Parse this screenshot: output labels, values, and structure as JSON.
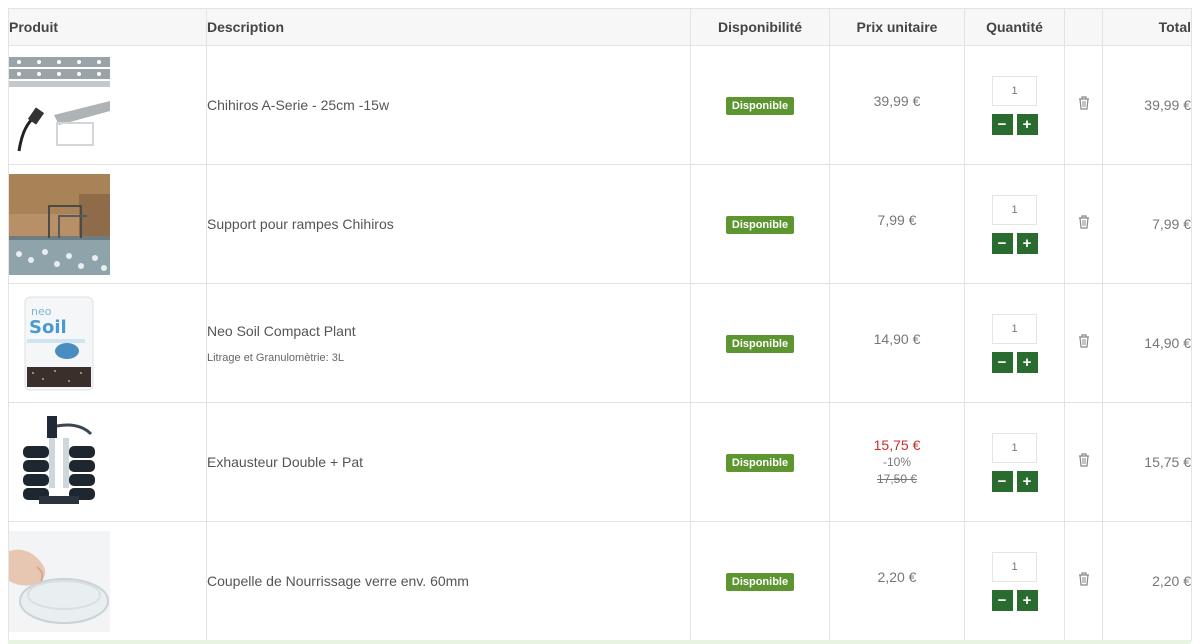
{
  "headers": {
    "product": "Produit",
    "description": "Description",
    "availability": "Disponibilité",
    "unit_price": "Prix unitaire",
    "quantity": "Quantité",
    "remove": "",
    "total": "Total"
  },
  "qty_controls": {
    "minus": "−",
    "plus": "+"
  },
  "items": [
    {
      "name": "Chihiros A-Serie - 25cm -15w",
      "attribute": "",
      "availability": "Disponible",
      "price": "39,99 €",
      "quantity": "1",
      "total": "39,99 €",
      "image_icon": "led-light-icon"
    },
    {
      "name": "Support pour rampes Chihiros",
      "attribute": "",
      "availability": "Disponible",
      "price": "7,99 €",
      "quantity": "1",
      "total": "7,99 €",
      "image_icon": "support-photo"
    },
    {
      "name": "Neo Soil Compact Plant",
      "attribute": "Litrage et Granulomètrie: 3L",
      "availability": "Disponible",
      "price": "14,90 €",
      "quantity": "1",
      "total": "14,90 €",
      "image_icon": "soil-bag-icon"
    },
    {
      "name": "Exhausteur Double + Pat",
      "attribute": "",
      "availability": "Disponible",
      "price_sale": "15,75 €",
      "discount": "-10%",
      "price_old": "17,50 €",
      "quantity": "1",
      "total": "15,75 €",
      "image_icon": "sponge-filter-icon"
    },
    {
      "name": "Coupelle de Nourrissage verre env. 60mm",
      "attribute": "",
      "availability": "Disponible",
      "price": "2,20 €",
      "quantity": "1",
      "total": "2,20 €",
      "image_icon": "glass-dish-icon"
    }
  ],
  "colors": {
    "badge": "#5d9630",
    "qty_button": "#2a6b2f",
    "sale_price": "#c9302c"
  }
}
